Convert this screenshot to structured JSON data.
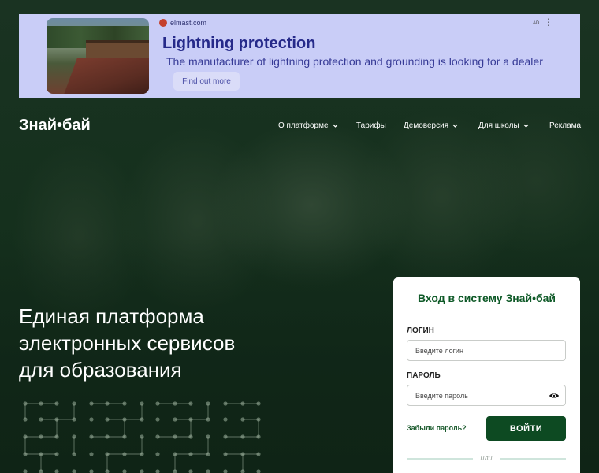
{
  "ad": {
    "site": "elmast.com",
    "title": "Lightning protection",
    "description": "The manufacturer of lightning protection and grounding is looking for a dealer",
    "button": "Find out more",
    "label": "AD",
    "menu_icon": "kebab-menu-icon",
    "colors": {
      "background": "#c9cdf7",
      "title": "#262a8a"
    }
  },
  "header": {
    "logo": "Знай•бай",
    "nav": [
      {
        "label": "О платформе",
        "dropdown": true
      },
      {
        "label": "Тарифы",
        "dropdown": false
      },
      {
        "label": "Демоверсия",
        "dropdown": true
      },
      {
        "label": "Для школы",
        "dropdown": true
      },
      {
        "label": "Реклама",
        "dropdown": false
      }
    ]
  },
  "hero": {
    "line1": "Единая платформа",
    "line2": "электронных сервисов",
    "line3": "для образования"
  },
  "login": {
    "title": "Вход в систему Знай•бай",
    "login_label": "ЛОГИН",
    "login_placeholder": "Введите логин",
    "password_label": "ПАРОЛЬ",
    "password_placeholder": "Введите пароль",
    "forgot": "Забыли пароль?",
    "submit": "ВОЙТИ",
    "or": "или",
    "colors": {
      "accent": "#0d4a22",
      "title": "#0f5a28"
    }
  }
}
